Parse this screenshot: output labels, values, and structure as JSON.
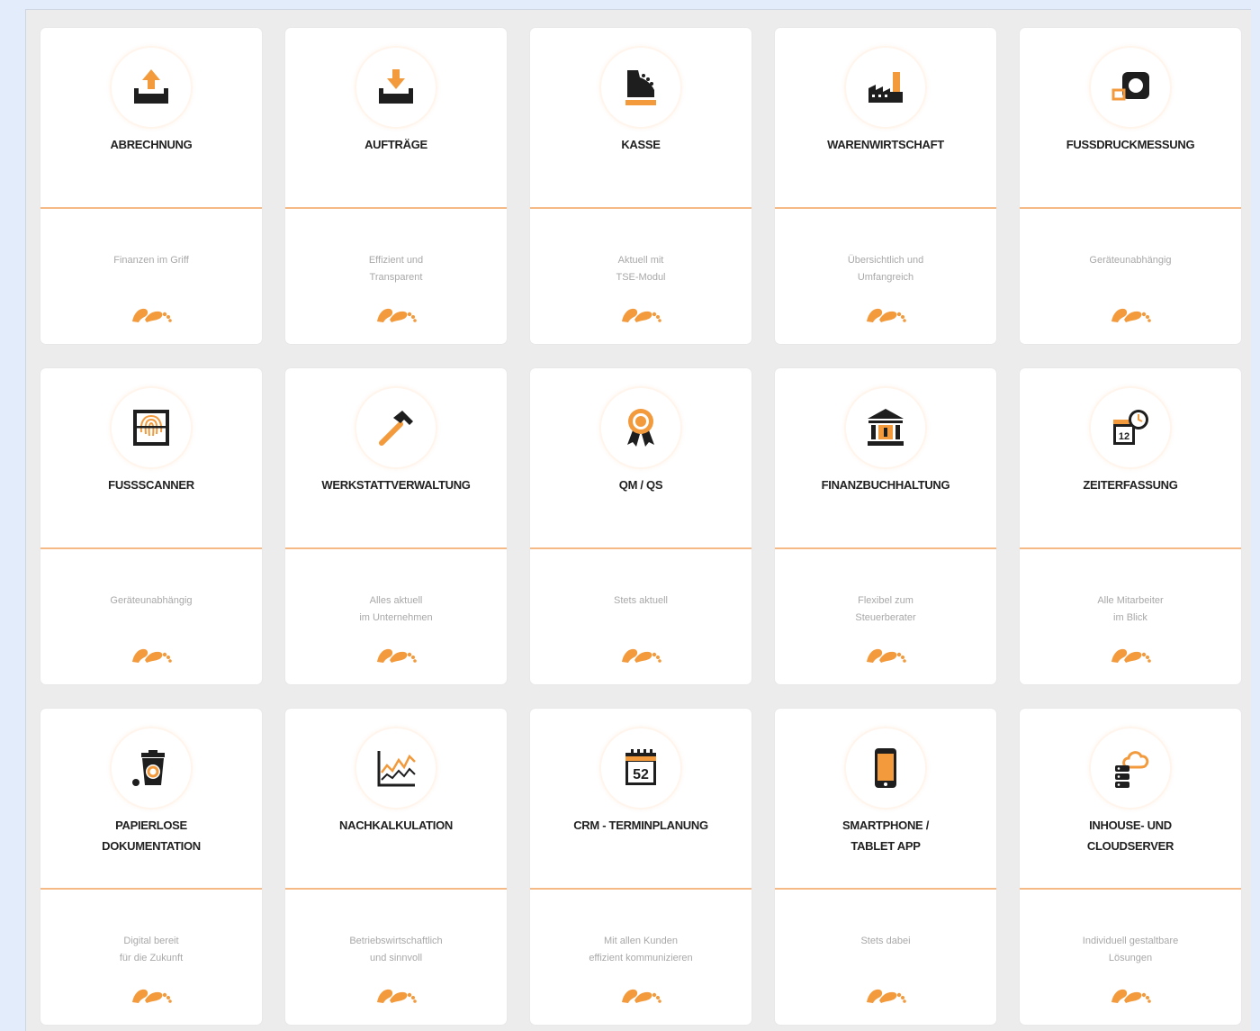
{
  "colors": {
    "accent": "#f29a3c",
    "icon_dark": "#1e1e1e",
    "separator": "#f5b985",
    "subtitle": "#a8a8a8"
  },
  "cards": [
    {
      "icon": "upload-tray-icon",
      "title": "ABRECHNUNG",
      "subtitle": "Finanzen im Griff"
    },
    {
      "icon": "download-tray-icon",
      "title": "AUFTRÄGE",
      "subtitle": "Effizient und\nTransparent"
    },
    {
      "icon": "cash-register-icon",
      "title": "KASSE",
      "subtitle": "Aktuell mit\nTSE-Modul"
    },
    {
      "icon": "factory-icon",
      "title": "WARENWIRTSCHAFT",
      "subtitle": "Übersichtlich und\nUmfangreich"
    },
    {
      "icon": "foot-pressure-sensor-icon",
      "title": "FUSSDRUCKMESSUNG",
      "subtitle": "Geräteunabhängig"
    },
    {
      "icon": "fingerprint-scanner-icon",
      "title": "FUSSSCANNER",
      "subtitle": "Geräteunabhängig"
    },
    {
      "icon": "hammer-icon",
      "title": "WERKSTATTVERWALTUNG",
      "subtitle": "Alles aktuell\nim Unternehmen"
    },
    {
      "icon": "award-ribbon-icon",
      "title": "QM / QS",
      "subtitle": "Stets aktuell"
    },
    {
      "icon": "bank-icon",
      "title": "FINANZBUCHHALTUNG",
      "subtitle": "Flexibel zum\nSteuerberater"
    },
    {
      "icon": "calendar-clock-icon",
      "title": "ZEITERFASSUNG",
      "subtitle": "Alle Mitarbeiter\nim Blick"
    },
    {
      "icon": "recycle-bin-icon",
      "title": "PAPIERLOSE\nDOKUMENTATION",
      "subtitle": "Digital bereit\nfür die Zukunft"
    },
    {
      "icon": "line-chart-icon",
      "title": "NACHKALKULATION",
      "subtitle": "Betriebswirtschaftlich\nund sinnvoll"
    },
    {
      "icon": "calendar-52-icon",
      "title": "CRM - TERMINPLANUNG",
      "subtitle": "Mit allen Kunden\neffizient kommunizieren"
    },
    {
      "icon": "smartphone-icon",
      "title": "SMARTPHONE /\nTABLET APP",
      "subtitle": "Stets dabei"
    },
    {
      "icon": "cloud-server-icon",
      "title": "INHOUSE- UND\nCLOUDSERVER",
      "subtitle": "Individuell gestaltbare\nLösungen"
    }
  ],
  "calendar_number": "52",
  "footer_icon": "footprints-icon"
}
